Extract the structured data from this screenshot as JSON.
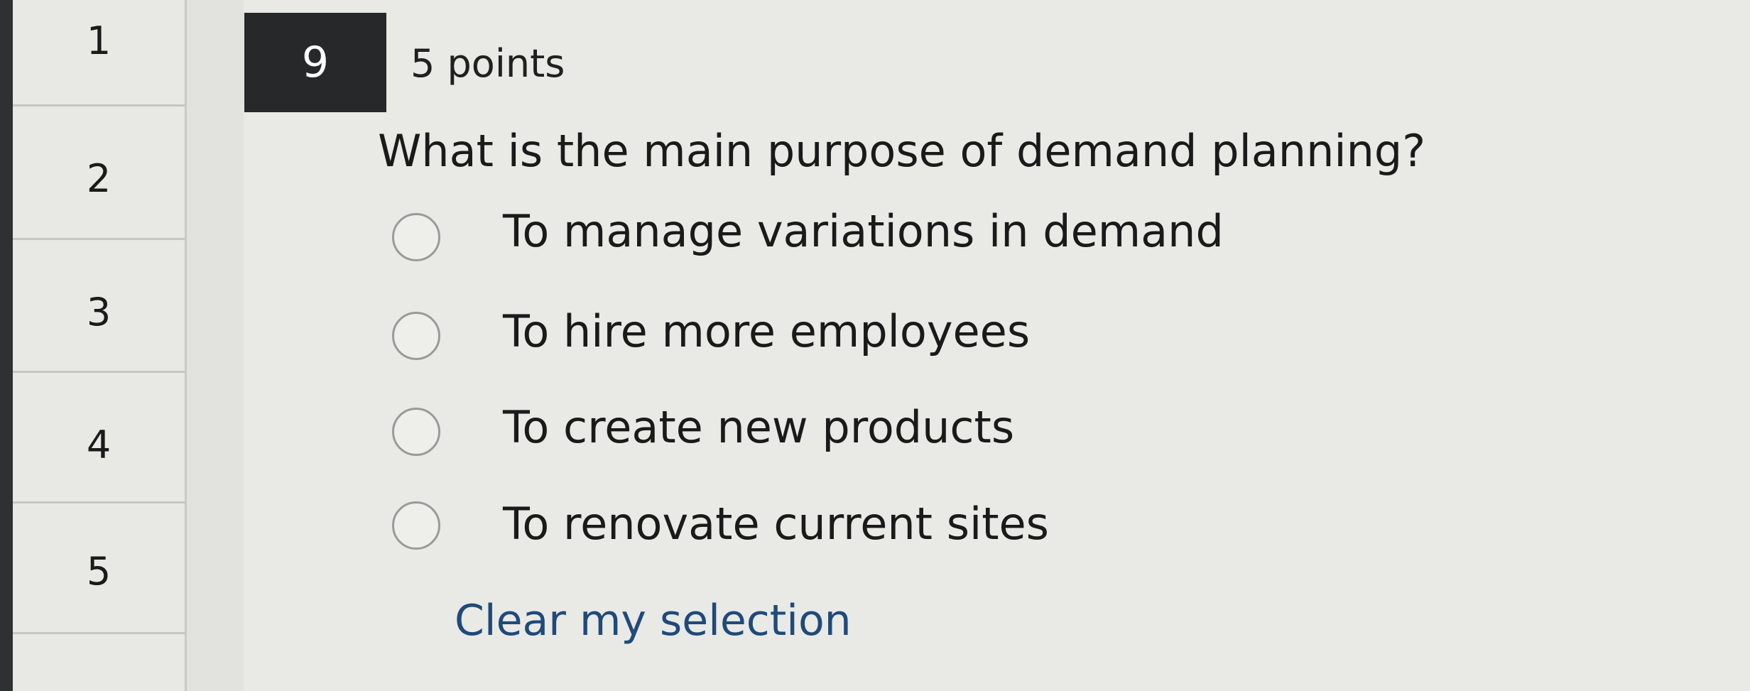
{
  "navigator": {
    "items": [
      {
        "number": "1"
      },
      {
        "number": "2"
      },
      {
        "number": "3"
      },
      {
        "number": "4"
      },
      {
        "number": "5"
      }
    ]
  },
  "question": {
    "number": "9",
    "points": "5 points",
    "text": "What is the main purpose of demand planning?",
    "options": [
      {
        "label": "To manage variations in demand"
      },
      {
        "label": "To hire more employees"
      },
      {
        "label": "To create new products"
      },
      {
        "label": "To renovate current sites"
      }
    ],
    "clear_label": "Clear my selection"
  },
  "colors": {
    "badge_background": "#262829",
    "link": "#1f4a7a"
  }
}
